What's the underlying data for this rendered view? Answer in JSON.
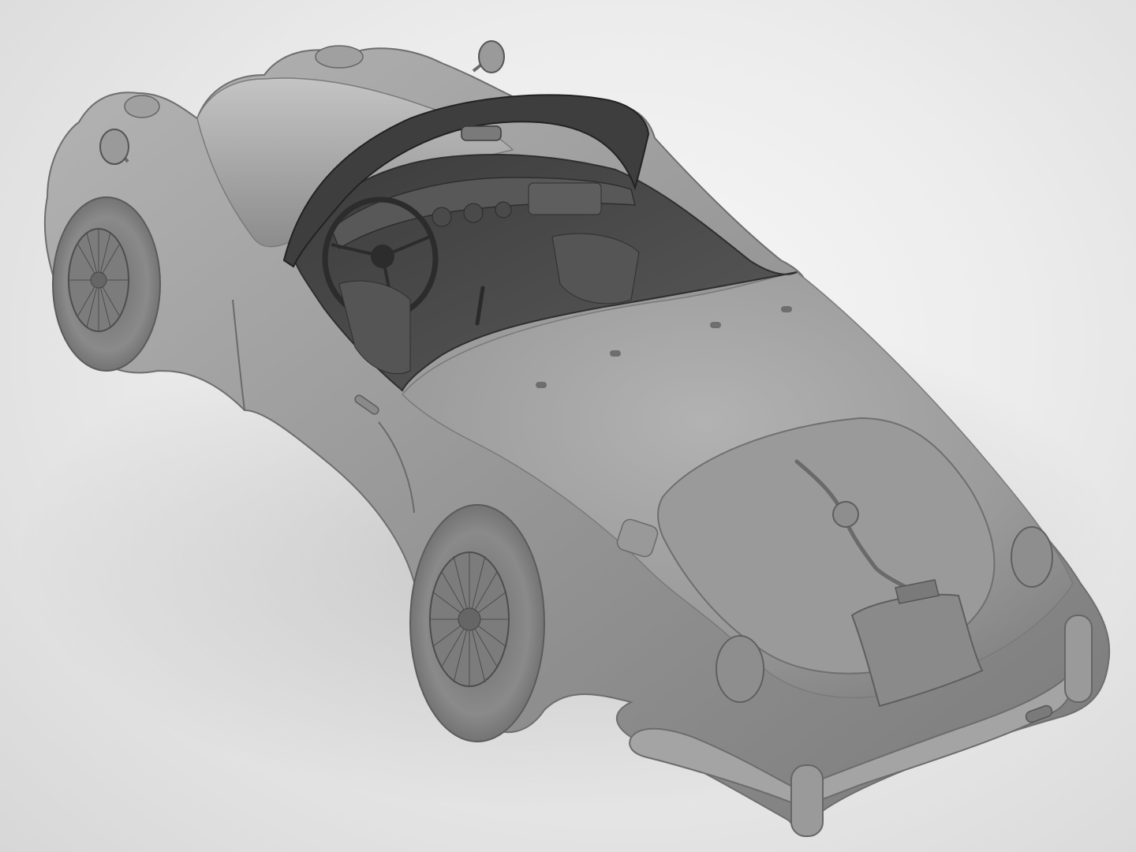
{
  "scene": {
    "subject": "clay-render-roadster",
    "background_color": "#e9e9e9",
    "body_color": "#8f8f8f",
    "interior_color": "#3a3a3a"
  },
  "badge": {
    "text": ""
  }
}
